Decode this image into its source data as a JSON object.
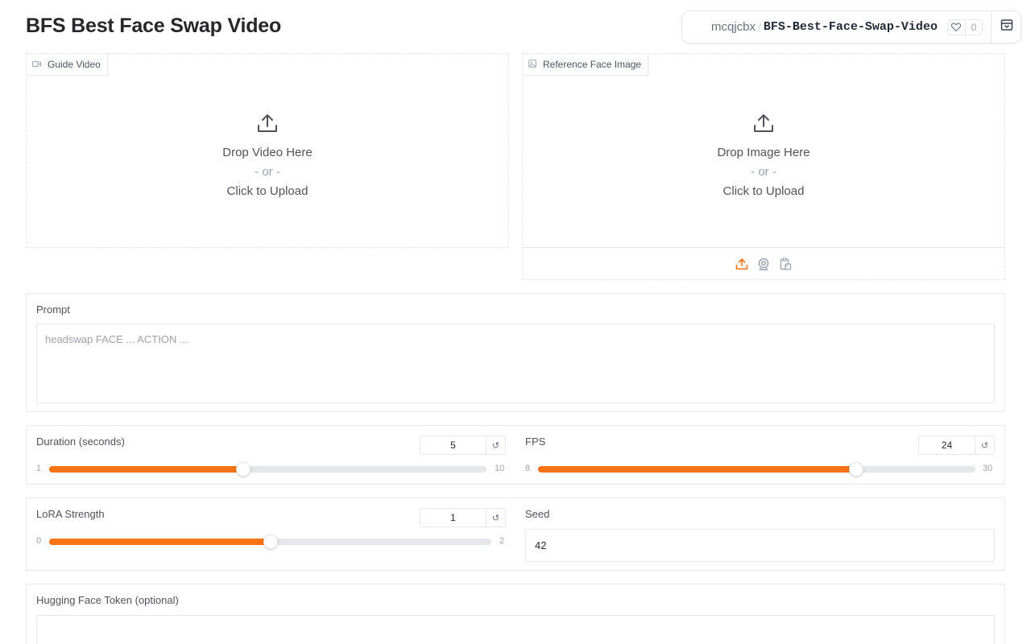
{
  "page": {
    "title": "BFS Best Face Swap Video"
  },
  "space": {
    "owner": "mcqjcbx",
    "separator": "/",
    "repo": "BFS-Best-Face-Swap-Video",
    "likes": "0"
  },
  "guide_video": {
    "label": "Guide Video",
    "drop_text": "Drop Video Here",
    "or_text": "- or -",
    "click_text": "Click to Upload"
  },
  "reference_face": {
    "label": "Reference Face Image",
    "drop_text": "Drop Image Here",
    "or_text": "- or -",
    "click_text": "Click to Upload",
    "sources": [
      "upload-icon",
      "webcam-icon",
      "clipboard-icon"
    ]
  },
  "prompt": {
    "label": "Prompt",
    "placeholder": "headswap FACE ... ACTION ..."
  },
  "duration": {
    "label": "Duration (seconds)",
    "value": "5",
    "min": "1",
    "max": "10",
    "fraction": 0.444
  },
  "fps": {
    "label": "FPS",
    "value": "24",
    "min": "8",
    "max": "30",
    "fraction": 0.727
  },
  "lora": {
    "label": "LoRA Strength",
    "value": "1",
    "min": "0",
    "max": "2",
    "fraction": 0.5
  },
  "seed": {
    "label": "Seed",
    "value": "42"
  },
  "hf_token": {
    "label": "Hugging Face Token (optional)",
    "value": ""
  },
  "colors": {
    "accent": "#f97316",
    "border": "#e5e7eb",
    "text": "#27272a"
  }
}
